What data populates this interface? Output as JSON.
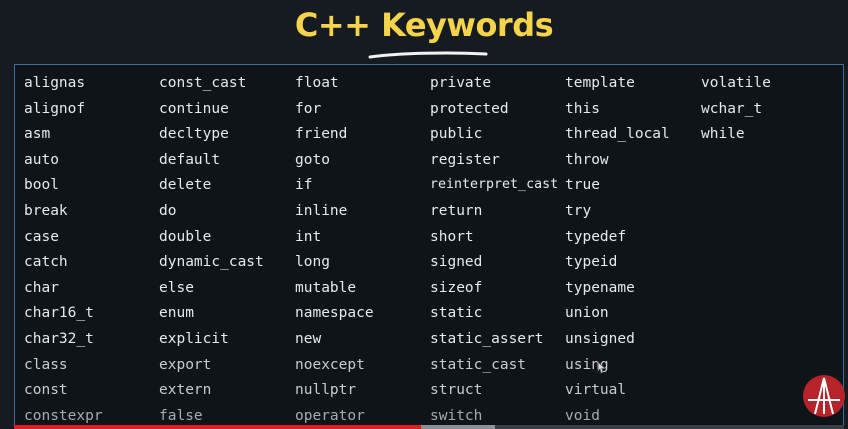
{
  "title": "C++ Keywords",
  "columns": [
    [
      "alignas",
      "alignof",
      "asm",
      "auto",
      "bool",
      "break",
      "case",
      "catch",
      "char",
      "char16_t",
      "char32_t",
      "class",
      "const",
      "constexpr"
    ],
    [
      "const_cast",
      "continue",
      "decltype",
      "default",
      "delete",
      "do",
      "double",
      "dynamic_cast",
      "else",
      "enum",
      "explicit",
      "export",
      "extern",
      "false"
    ],
    [
      "float",
      "for",
      "friend",
      "goto",
      "if",
      "inline",
      "int",
      "long",
      "mutable",
      "namespace",
      "new",
      "noexcept",
      "nullptr",
      "operator"
    ],
    [
      "private",
      "protected",
      "public",
      "register",
      "reinterpret_cast",
      "return",
      "short",
      "signed",
      "sizeof",
      "static",
      "static_assert",
      "static_cast",
      "struct",
      "switch"
    ],
    [
      "template",
      "this",
      "thread_local",
      "throw",
      "true",
      "try",
      "typedef",
      "typeid",
      "typename",
      "union",
      "unsigned",
      "using",
      "virtual",
      "void"
    ],
    [
      "volatile",
      "wchar_t",
      "while"
    ]
  ],
  "progress": {
    "played_fraction": 0.49,
    "buffered_fraction": 0.58
  },
  "colors": {
    "title": "#f6d44a",
    "panel_border": "#3e6da0",
    "progress": "#e21d24",
    "logo": "#b7232b"
  },
  "icons": {
    "logo": "channel-logo-icon",
    "cursor": "mouse-cursor-icon"
  }
}
